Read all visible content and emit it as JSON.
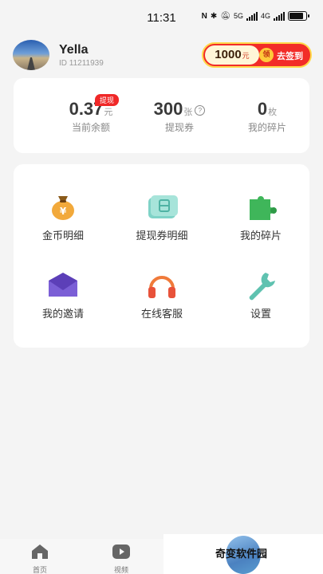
{
  "status_bar": {
    "time": "11:31",
    "network_1": "5G",
    "network_2": "4G"
  },
  "profile": {
    "name": "Yella",
    "id_label": "ID",
    "id_value": "11211939"
  },
  "checkin": {
    "amount": "1000",
    "unit": "元",
    "coin_char": "领",
    "label": "去签到"
  },
  "stats": {
    "balance": {
      "value": "0.37",
      "unit": "元",
      "label": "当前余额",
      "badge": "提现"
    },
    "vouchers": {
      "value": "300",
      "unit": "张",
      "label": "提现券",
      "help": "?"
    },
    "fragments": {
      "value": "0",
      "unit": "枚",
      "label": "我的碎片"
    }
  },
  "menu": {
    "items": [
      {
        "label": "金币明细",
        "icon": "money-bag-icon"
      },
      {
        "label": "提现券明细",
        "icon": "voucher-icon"
      },
      {
        "label": "我的碎片",
        "icon": "puzzle-icon"
      },
      {
        "label": "我的邀请",
        "icon": "envelope-icon"
      },
      {
        "label": "在线客服",
        "icon": "headphones-icon"
      },
      {
        "label": "设置",
        "icon": "wrench-icon"
      }
    ]
  },
  "tabbar": {
    "tabs": [
      {
        "label": "首页",
        "icon": "home-icon"
      },
      {
        "label": "视频",
        "icon": "video-play-icon"
      }
    ]
  },
  "watermark": {
    "text": "奇变软件园"
  },
  "colors": {
    "accent_red": "#f02828",
    "gold": "#ffc93a",
    "background": "#f4f4f4"
  }
}
